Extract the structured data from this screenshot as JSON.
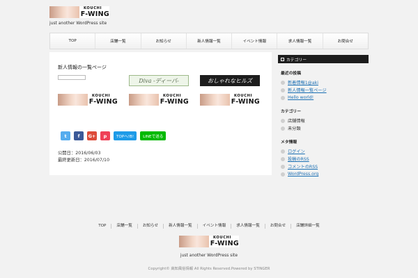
{
  "header": {
    "logo_top": "KOUCHI",
    "logo_bottom": "F-WING",
    "tagline": "just another WordPress site"
  },
  "nav": [
    "TOP",
    "店舗一覧",
    "お知らせ",
    "新人情報一覧",
    "イベント情報",
    "求人情報一覧",
    "お問合せ"
  ],
  "main": {
    "post_title": "新人情報の一覧ページ",
    "banner_dva": "Diva -ディーバ-",
    "banner_hills": "おしゃれなヒルズ",
    "logo_banner_top": "KOUCHI",
    "logo_banner_bottom": "F-WING",
    "share": {
      "twitter": "t",
      "facebook": "f",
      "google": "G+",
      "pocket": "p",
      "top_button": "TOPへ!B!",
      "line_button": "LINEで送る"
    },
    "published": "公開日：2016/06/03",
    "updated": "最終更新日：2016/07/10"
  },
  "sidebar": {
    "header": "カテゴリー",
    "sections": [
      {
        "title": "最近の投稿",
        "items": [
          {
            "text": "新着情報1@aki",
            "link": true
          },
          {
            "text": "新人情報一覧ページ",
            "link": true
          },
          {
            "text": "Hello world!",
            "link": true
          }
        ]
      },
      {
        "title": "カテゴリー",
        "items": [
          {
            "text": "店舗情報",
            "link": false
          },
          {
            "text": "未分類",
            "link": false
          }
        ]
      },
      {
        "title": "メタ情報",
        "items": [
          {
            "text": "ログイン",
            "link": true
          },
          {
            "text": "投稿のRSS",
            "link": true
          },
          {
            "text": "コメントのRSS",
            "link": true
          },
          {
            "text": "WordPress.org",
            "link": true
          }
        ]
      }
    ]
  },
  "footer": {
    "nav": [
      "TOP",
      "店舗一覧",
      "お知らせ",
      "新人情報一覧",
      "イベント情報",
      "求人情報一覧",
      "お問合せ",
      "店舗詳細一覧"
    ],
    "tagline": "just another WordPress site",
    "copyright": "Copyright© 高知風俗情報 All Rights Reserved.Powered by STINGER"
  }
}
